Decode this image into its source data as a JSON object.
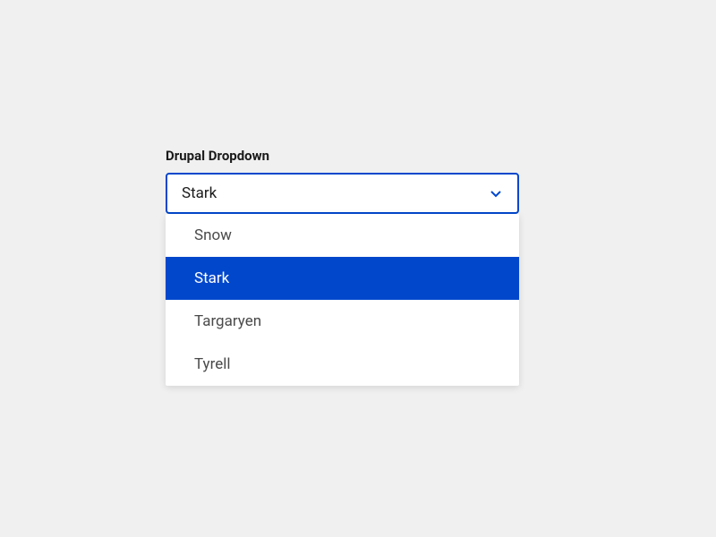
{
  "dropdown": {
    "label": "Drupal Dropdown",
    "selected": "Stark",
    "options": [
      {
        "label": "Snow",
        "selected": false
      },
      {
        "label": "Stark",
        "selected": true
      },
      {
        "label": "Targaryen",
        "selected": false
      },
      {
        "label": "Tyrell",
        "selected": false
      }
    ],
    "colors": {
      "accent": "#0047cc",
      "background": "#f0f0f0"
    }
  }
}
